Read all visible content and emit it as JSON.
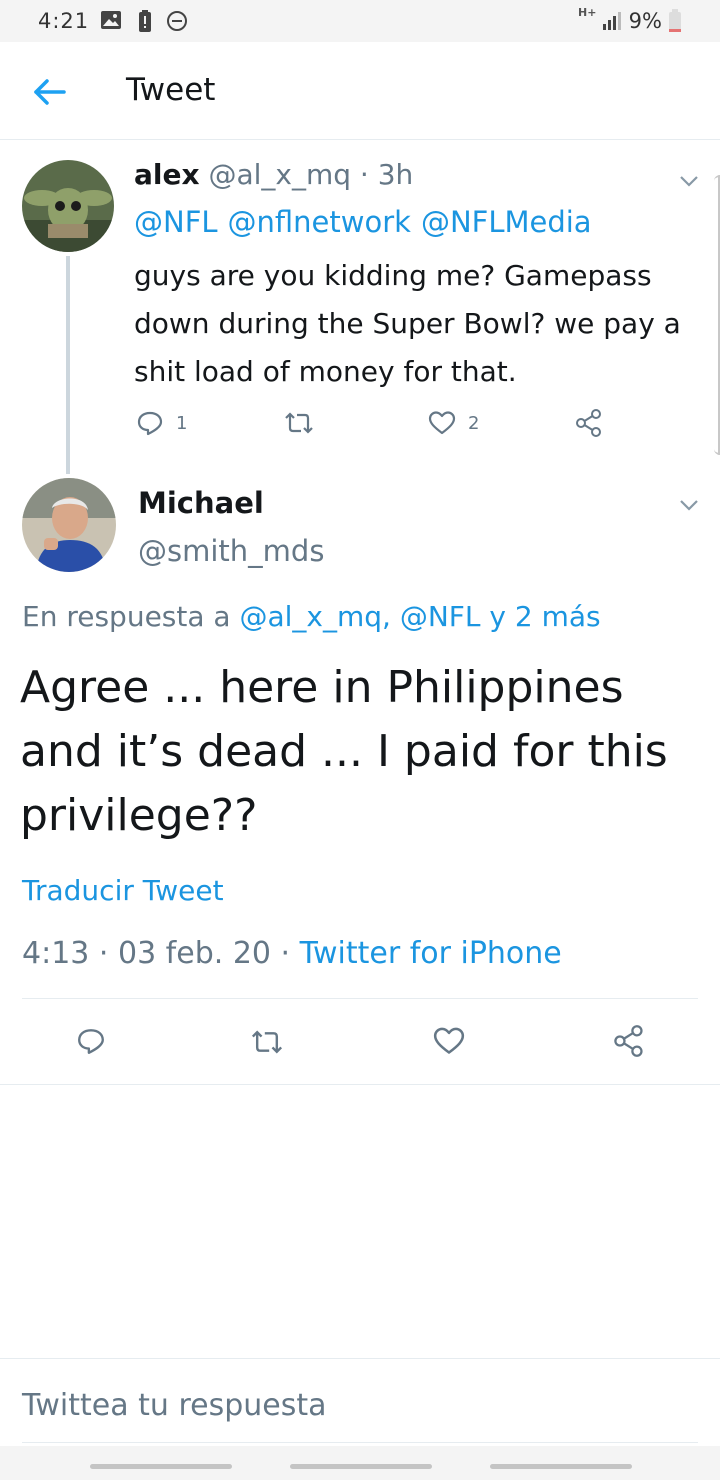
{
  "status_bar": {
    "time": "4:21",
    "network": "H+",
    "battery_pct": "9%",
    "icons": [
      "image-icon",
      "battery-alert-icon",
      "do-not-disturb-icon",
      "network-type-icon",
      "signal-icon",
      "battery-icon"
    ]
  },
  "header": {
    "title": "Tweet",
    "back_icon": "arrow-left-icon"
  },
  "parent_tweet": {
    "name": "alex",
    "handle": "@al_x_mq",
    "separator": "·",
    "time_ago": "3h",
    "mentions": [
      "@NFL",
      "@nflnetwork",
      "@NFLMedia"
    ],
    "text": "guys are you kidding me? Gamepass down during the Super Bowl? we pay a shit load of money for that.",
    "reply_count": "1",
    "like_count": "2"
  },
  "main_tweet": {
    "name": "Michael",
    "handle": "@smith_mds",
    "reply_prefix": "En respuesta a ",
    "reply_targets": "@al_x_mq, @NFL y 2 más",
    "text": "Agree ... here in Philippines and it’s dead ... I paid for this privilege??",
    "translate_label": "Traducir Tweet",
    "timestamp": "4:13 · 03 feb. 20 · ",
    "source": "Twitter for iPhone"
  },
  "reply_input": {
    "placeholder": "Twittea tu respuesta"
  },
  "colors": {
    "link": "#1b95e0",
    "muted": "#657786",
    "text": "#14171a",
    "divider": "#e6ecf0"
  }
}
